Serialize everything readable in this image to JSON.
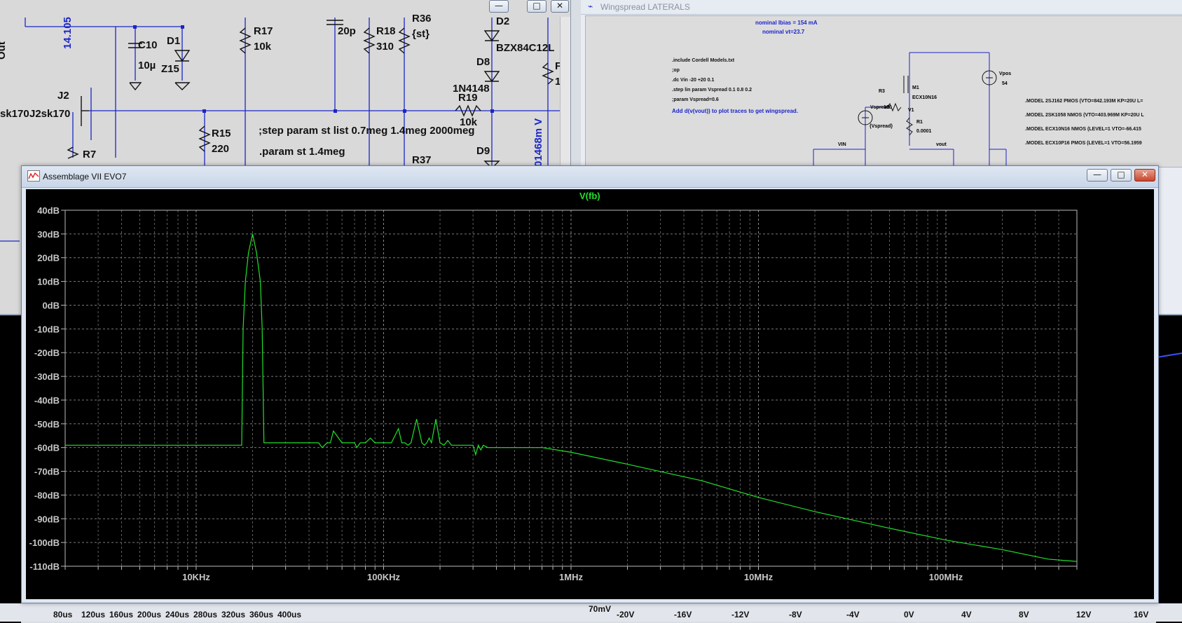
{
  "left_schematic": {
    "labels": {
      "out": "Out",
      "v14": "14.105",
      "c10": "C10",
      "c10_val": "10µ",
      "d1": "D1",
      "z15": "Z15",
      "r17": "R17",
      "r17_val": "10k",
      "c20p": "20p",
      "r18": "R18",
      "r18_val": "310",
      "r36": "R36",
      "r36_val": "{st}",
      "d2": "D2",
      "bzx": "BZX84C12L",
      "d8": "D8",
      "rtrunc": "F",
      "one": "1",
      "j2": "J2",
      "j2sk": "J2sk170",
      "sk170": "sk170",
      "r7": "R7",
      "r15": "R15",
      "r15_val": "220",
      "n4148": "1N4148",
      "r19": "R19",
      "r19_val": "10k",
      "r37": "R37",
      "d9": "D9",
      "volt": "01468m V",
      "step": ";step param st list 0.7meg  1.4meg 2000meg",
      "param": ".param st 1.4meg"
    },
    "buttons": {
      "min": "—",
      "max": "□",
      "close": "✕"
    }
  },
  "right_schematic": {
    "title": "Wingspread LATERALS",
    "nominal_ibias": "nominal Ibias = 154 mA",
    "nominal_vt": "nominal vt=23.7",
    "directives": [
      ".include Cordell Models.txt",
      ";op",
      ".dc Vin -20 +20 0.1",
      ".step lin param Vspread 0.1 0.8 0.2",
      ";param Vspread=0.6"
    ],
    "hint": "Add d(v(vout)) to plot traces to get wingspread.",
    "models": [
      ".MODEL 2SJ162 PMOS (VTO=842.193M KP=20U L=",
      ".MODEL 2SK1058 NMOS (VTO=403.969M KP=20U L",
      ".MODEL ECX10N16 NMOS (LEVEL=1 VTO=-66.415",
      ".MODEL ECX10P16 PMOS (LEVEL=1 VTO=56.1959"
    ],
    "parts": {
      "m1": "M1",
      "ecx": "ECX10N16",
      "r3": "R3",
      "vspread": "Vspread",
      "r3v": "100",
      "vspread_param": "{Vspread}",
      "r1": "R1",
      "r1v": "0.0001",
      "vpos": "Vpos",
      "vpos_val": "54",
      "vin": "VIN",
      "vout": "vout",
      "v1": "V1"
    }
  },
  "plot_window": {
    "title": "Assemblage VII EVO7",
    "trace_name": "V(fb)",
    "buttons": {
      "min": "—",
      "max": "□",
      "close": "✕"
    },
    "trace_color": "#22e02c"
  },
  "chart_data": {
    "type": "line",
    "title": "",
    "series": [
      {
        "name": "V(fb)"
      }
    ],
    "ylabel": "",
    "xlabel": "",
    "x_scale": "log",
    "xlim": [
      2000,
      500000000
    ],
    "ylim": [
      -110,
      40
    ],
    "y_ticks": [
      "40dB",
      "30dB",
      "20dB",
      "10dB",
      "0dB",
      "-10dB",
      "-20dB",
      "-30dB",
      "-40dB",
      "-50dB",
      "-60dB",
      "-70dB",
      "-80dB",
      "-90dB",
      "-100dB",
      "-110dB"
    ],
    "y_tick_values": [
      40,
      30,
      20,
      10,
      0,
      -10,
      -20,
      -30,
      -40,
      -50,
      -60,
      -70,
      -80,
      -90,
      -100,
      -110
    ],
    "x_ticks": [
      "10KHz",
      "100KHz",
      "1MHz",
      "10MHz",
      "100MHz"
    ],
    "x_tick_values": [
      10000,
      100000,
      1000000,
      10000000,
      100000000
    ],
    "grid": true,
    "x": [
      2000,
      9000,
      17500,
      17800,
      18300,
      19000,
      20000,
      21000,
      22000,
      22500,
      23000,
      23500,
      30000,
      45000,
      47000,
      50000,
      52000,
      54000,
      60000,
      70000,
      72000,
      75000,
      80000,
      85000,
      90000,
      100000,
      110000,
      120000,
      125000,
      130000,
      135000,
      140000,
      150000,
      160000,
      165000,
      170000,
      175000,
      180000,
      190000,
      200000,
      210000,
      215000,
      220000,
      230000,
      250000,
      300000,
      310000,
      320000,
      330000,
      340000,
      360000,
      400000,
      500000,
      700000,
      1000000,
      2000000,
      5000000,
      10000000,
      20000000,
      50000000,
      100000000,
      200000000,
      350000000,
      500000000
    ],
    "y": [
      -59,
      -59,
      -59,
      -10,
      10,
      22,
      30,
      22,
      10,
      -10,
      -58,
      -58,
      -58,
      -58,
      -60,
      -58,
      -58,
      -53,
      -58,
      -58,
      -60,
      -58,
      -58,
      -56,
      -58,
      -58,
      -58,
      -52,
      -58,
      -58,
      -59,
      -58,
      -48,
      -58,
      -59,
      -58,
      -56,
      -58,
      -48,
      -58,
      -59,
      -58,
      -57,
      -59,
      -59,
      -59,
      -63,
      -59,
      -61,
      -59,
      -60,
      -60,
      -60,
      -60,
      -62,
      -67,
      -74,
      -81,
      -87,
      -94,
      -99,
      -103,
      -107,
      -108
    ]
  },
  "bottom_axis_left": [
    "80us",
    "120us",
    "160us",
    "200us",
    "240us",
    "280us",
    "320us",
    "360us",
    "400us"
  ],
  "bottom_axis_right": [
    "70mV",
    "-20V",
    "-16V",
    "-12V",
    "-8V",
    "-4V",
    "0V",
    "4V",
    "8V",
    "12V",
    "16V"
  ]
}
